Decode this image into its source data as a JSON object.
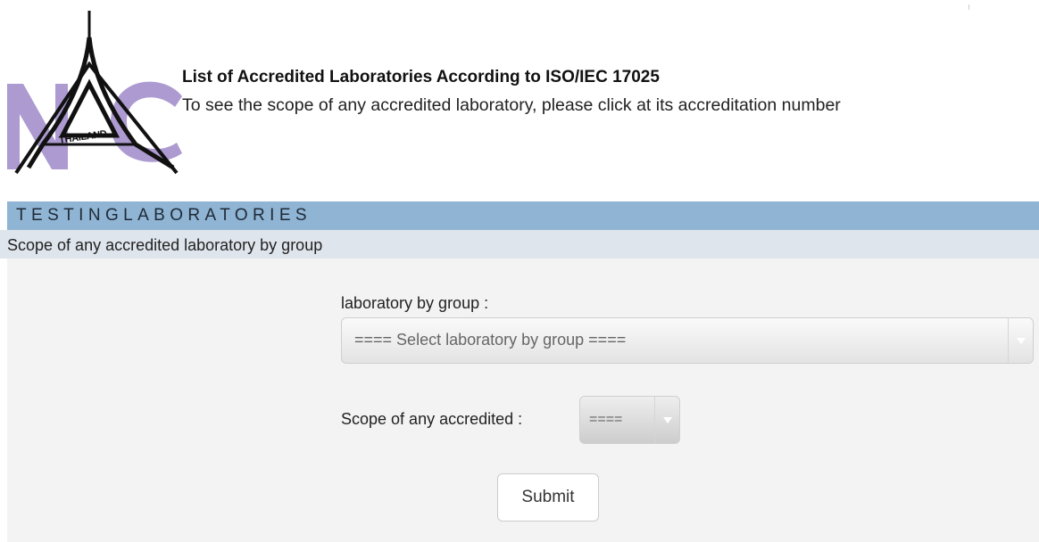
{
  "header": {
    "logo_text": "THAILAND",
    "title": "List of Accredited Laboratories According to ISO/IEC 17025",
    "subtitle": "To see the scope of any accredited laboratory, please click at its accreditation number"
  },
  "section": {
    "label": "TESTINGLABORATORIES",
    "sub_label": "Scope of any accredited laboratory by group"
  },
  "form": {
    "group_label": "laboratory by group :",
    "group_select_value": "==== Select laboratory by group ====",
    "scope_label": "Scope of any accredited :",
    "scope_select_value": "====",
    "submit_label": "Submit"
  },
  "colors": {
    "section_bar": "#8fb4d4",
    "sub_bar": "#dfe5ec",
    "form_background": "#f3f3f3",
    "logo_purple": "#a38fcb"
  },
  "icons": {
    "group_select_arrow": "chevron-down-icon",
    "scope_select_arrow": "chevron-down-icon"
  }
}
